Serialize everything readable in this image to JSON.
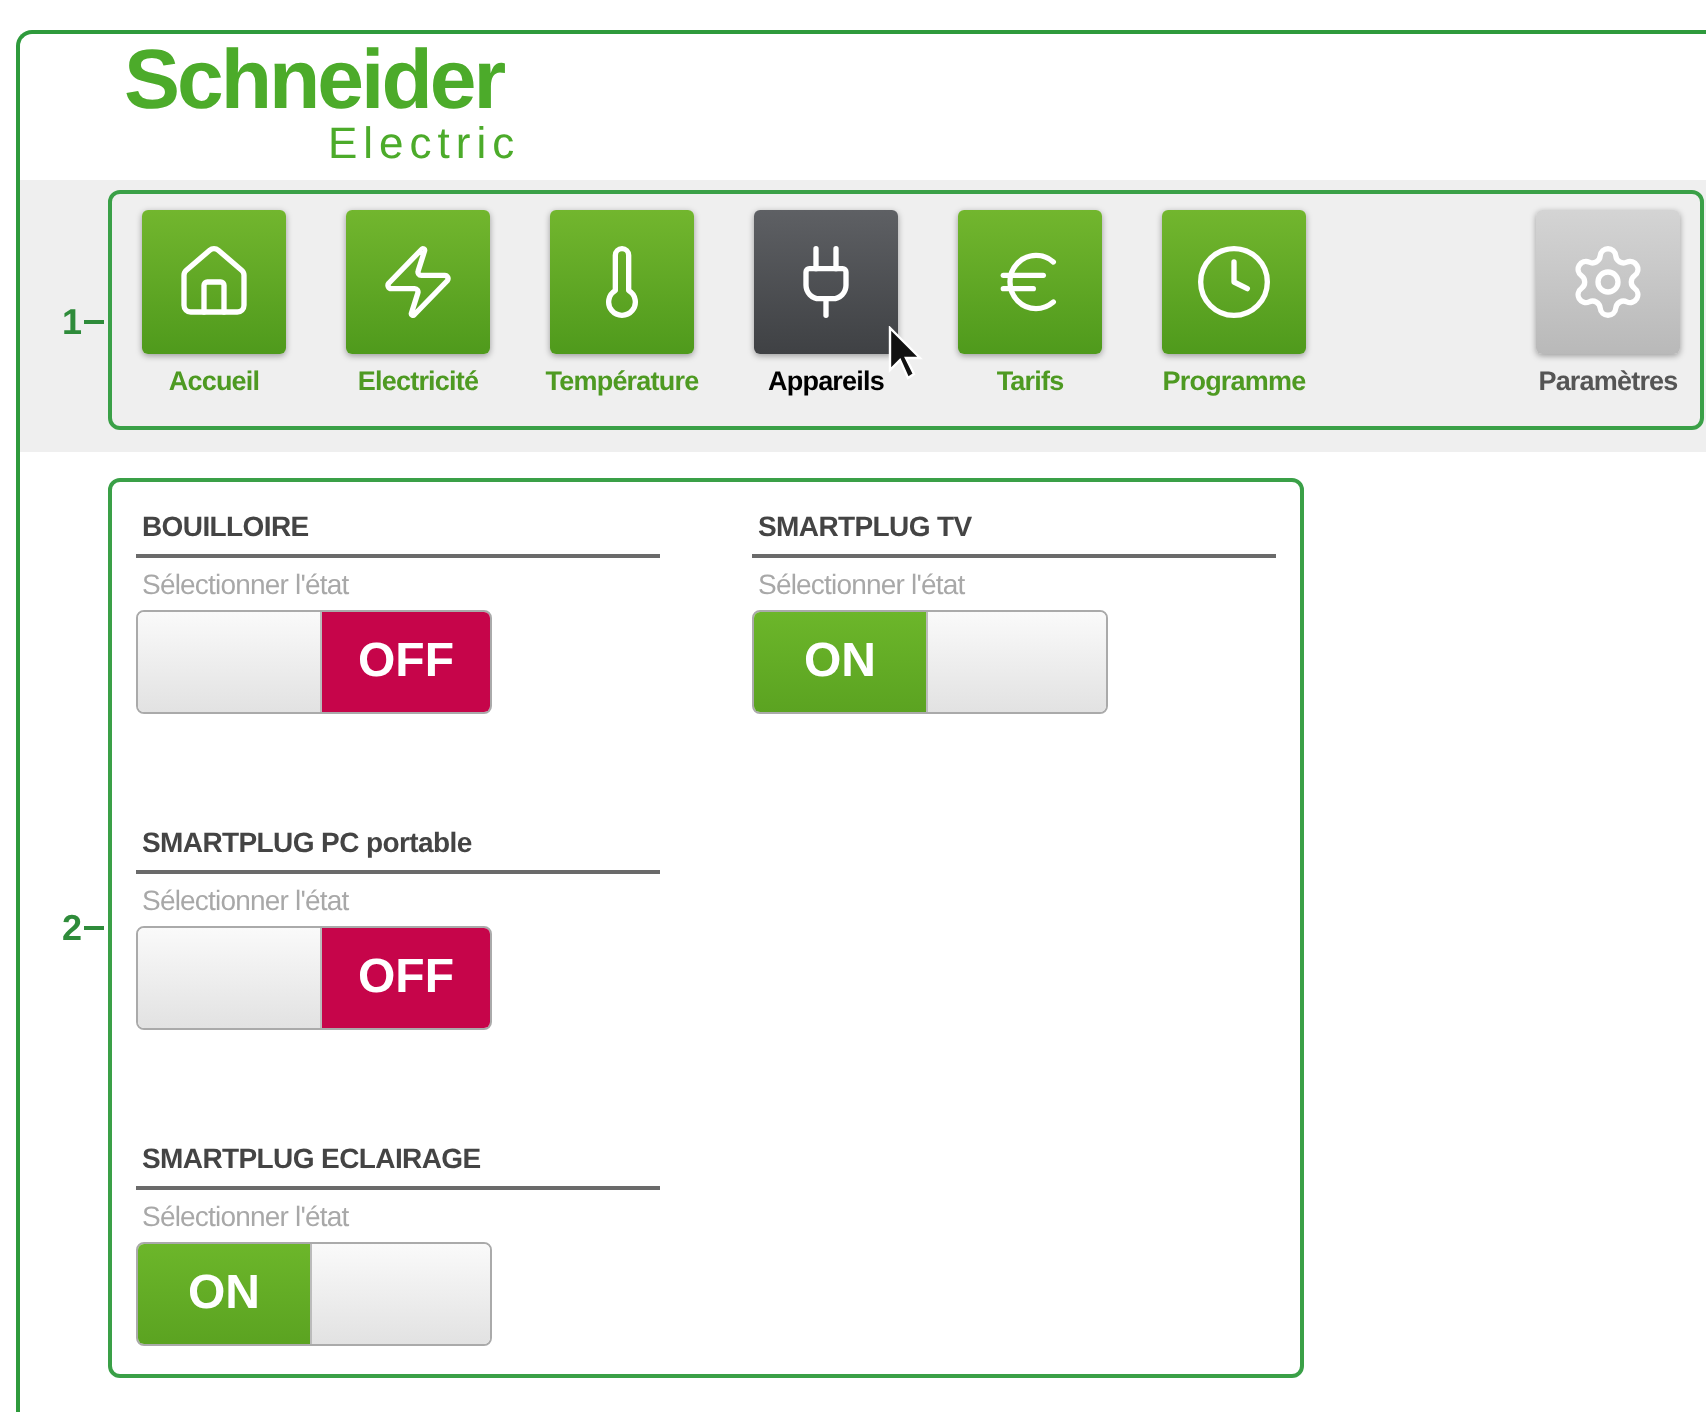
{
  "logo": {
    "brand": "Schneider",
    "sub": "Electric"
  },
  "callouts": [
    "1",
    "2"
  ],
  "nav": [
    {
      "label": "Accueil",
      "selected": false,
      "disabled": false
    },
    {
      "label": "Electricité",
      "selected": false,
      "disabled": false
    },
    {
      "label": "Température",
      "selected": false,
      "disabled": false
    },
    {
      "label": "Appareils",
      "selected": true,
      "disabled": false
    },
    {
      "label": "Tarifs",
      "selected": false,
      "disabled": false
    },
    {
      "label": "Programme",
      "selected": false,
      "disabled": false
    },
    {
      "label": "Paramètres",
      "selected": false,
      "disabled": true
    }
  ],
  "devices": [
    {
      "name": "BOUILLOIRE",
      "hint": "Sélectionner l'état",
      "on": false,
      "switch_label": "OFF"
    },
    {
      "name": "SMARTPLUG TV",
      "hint": "Sélectionner l'état",
      "on": true,
      "switch_label": "ON"
    },
    {
      "name": "SMARTPLUG PC portable",
      "hint": "Sélectionner l'état",
      "on": false,
      "switch_label": "OFF"
    },
    {
      "name": "SMARTPLUG ECLAIRAGE",
      "hint": "Sélectionner l'état",
      "on": true,
      "switch_label": "ON"
    }
  ]
}
